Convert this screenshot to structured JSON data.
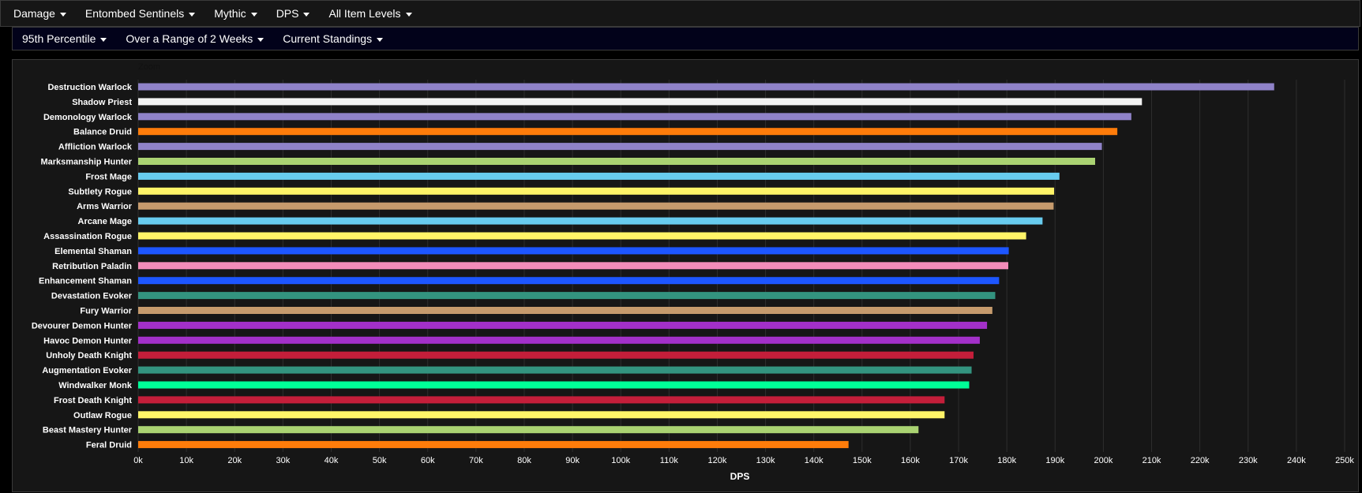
{
  "filters_top": [
    {
      "label": "Damage"
    },
    {
      "label": "Entombed Sentinels"
    },
    {
      "label": "Mythic"
    },
    {
      "label": "DPS"
    },
    {
      "label": "All Item Levels"
    }
  ],
  "filters_sub": [
    {
      "label": "95th Percentile"
    },
    {
      "label": "Over a Range of 2 Weeks"
    },
    {
      "label": "Current Standings"
    }
  ],
  "zoom_label": "Zoom",
  "chart_data": {
    "type": "bar",
    "orientation": "horizontal",
    "xlabel": "DPS",
    "xlim": [
      0,
      250000
    ],
    "xticks": [
      "0k",
      "10k",
      "20k",
      "30k",
      "40k",
      "50k",
      "60k",
      "70k",
      "80k",
      "90k",
      "100k",
      "110k",
      "120k",
      "130k",
      "140k",
      "150k",
      "160k",
      "170k",
      "180k",
      "190k",
      "200k",
      "210k",
      "220k",
      "230k",
      "240k",
      "250k"
    ],
    "grid": true,
    "categories": [
      "Destruction Warlock",
      "Shadow Priest",
      "Demonology Warlock",
      "Balance Druid",
      "Affliction Warlock",
      "Marksmanship Hunter",
      "Frost Mage",
      "Subtlety Rogue",
      "Arms Warrior",
      "Arcane Mage",
      "Assassination Rogue",
      "Elemental Shaman",
      "Retribution Paladin",
      "Enhancement Shaman",
      "Devastation Evoker",
      "Fury Warrior",
      "Devourer Demon Hunter",
      "Havoc Demon Hunter",
      "Unholy Death Knight",
      "Augmentation Evoker",
      "Windwalker Monk",
      "Frost Death Knight",
      "Outlaw Rogue",
      "Beast Mastery Hunter",
      "Feral Druid"
    ],
    "values": [
      235400,
      208000,
      205800,
      202900,
      199700,
      198300,
      190900,
      189800,
      189700,
      187400,
      184000,
      180400,
      180300,
      178400,
      177600,
      177000,
      175900,
      174400,
      173100,
      172700,
      172200,
      167100,
      167100,
      161700,
      147200
    ],
    "colors": [
      "#8f82c8",
      "#f2f2f2",
      "#8f82c8",
      "#ff7c0a",
      "#8f82c8",
      "#aad372",
      "#68ccef",
      "#fff468",
      "#c69b6d",
      "#68ccef",
      "#fff468",
      "#1d56ff",
      "#f48cba",
      "#1d56ff",
      "#33937f",
      "#c69b6d",
      "#a330c9",
      "#a330c9",
      "#c41e3a",
      "#33937f",
      "#00ff98",
      "#c41e3a",
      "#fff468",
      "#aad372",
      "#ff7c0a"
    ]
  }
}
